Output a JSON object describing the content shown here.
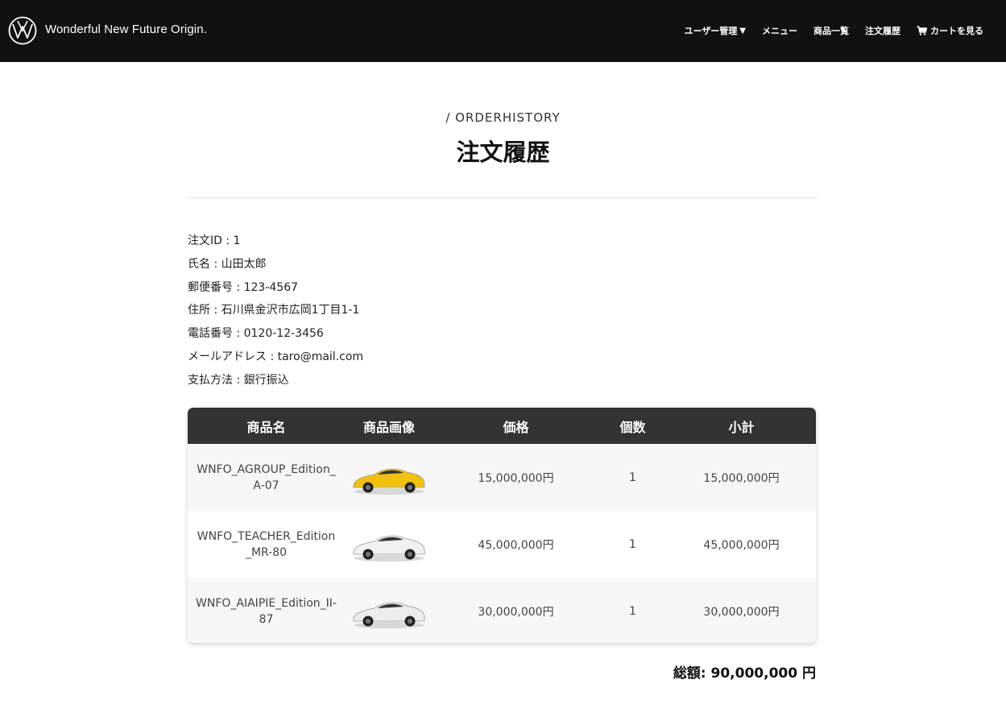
{
  "header": {
    "brand": "Wonderful New Future Origin.",
    "nav": {
      "user_admin": "ユーザー管理",
      "menu": "メニュー",
      "products": "商品一覧",
      "order_history": "注文履歴",
      "cart": "カートを見る"
    }
  },
  "page": {
    "subtitle": "/ ORDERHISTORY",
    "title": "注文履歴"
  },
  "order": {
    "id_line": "注文ID : 1",
    "name_line": "氏名 : 山田太郎",
    "postal_line": "郵便番号 : 123-4567",
    "address_line": "住所 : 石川県金沢市広岡1丁目1-1",
    "phone_line": "電話番号 : 0120-12-3456",
    "email_line": "メールアドレス : taro@mail.com",
    "payment_line": "支払方法 : 銀行振込"
  },
  "table": {
    "headers": [
      "商品名",
      "商品画像",
      "価格",
      "個数",
      "小計"
    ],
    "rows": [
      {
        "name": "WNFO_AGROUP_Edition_A-07",
        "car_color": "#f2c10f",
        "price": "15,000,000円",
        "qty": "1",
        "subtotal": "15,000,000円"
      },
      {
        "name": "WNFO_TEACHER_Edition_MR-80",
        "car_color": "#f1f1f1",
        "price": "45,000,000円",
        "qty": "1",
        "subtotal": "45,000,000円"
      },
      {
        "name": "WNFO_AIAIPIE_Edition_II-87",
        "car_color": "#ededed",
        "price": "30,000,000円",
        "qty": "1",
        "subtotal": "30,000,000円"
      }
    ]
  },
  "total": "総額: 90,000,000 円"
}
